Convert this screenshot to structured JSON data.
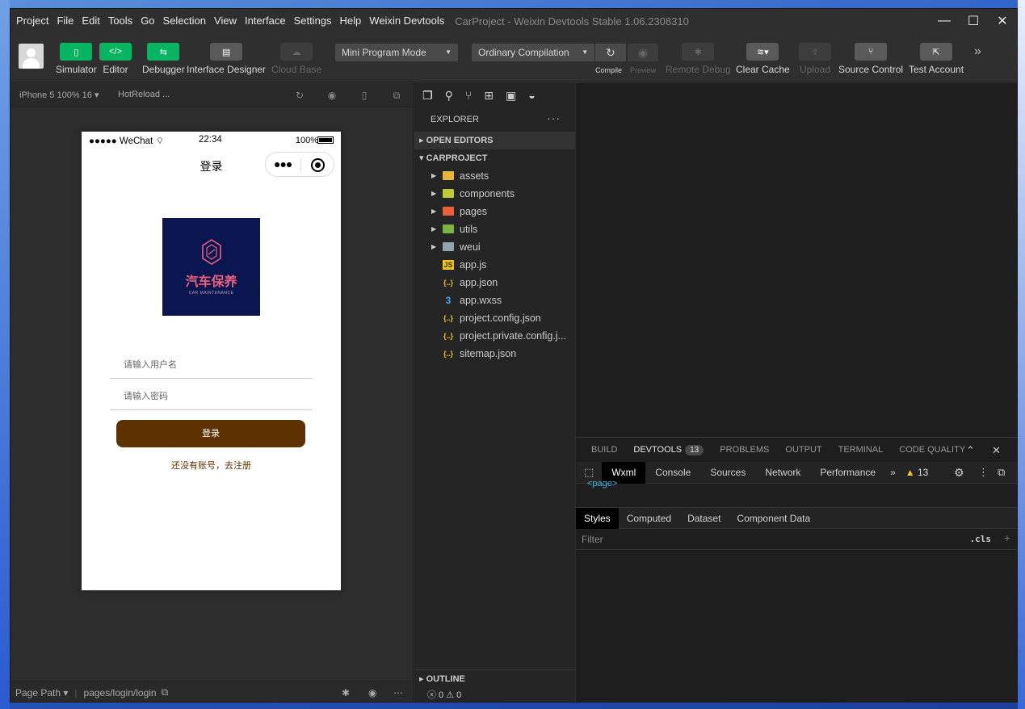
{
  "menu": [
    "Project",
    "File",
    "Edit",
    "Tools",
    "Go",
    "Selection",
    "View",
    "Interface",
    "Settings",
    "Help",
    "Weixin Devtools"
  ],
  "window_title": "CarProject - Weixin Devtools Stable 1.06.2308310",
  "toolbar": {
    "simulator": "Simulator",
    "editor": "Editor",
    "debugger": "Debugger",
    "interface_designer": "Interface Designer",
    "cloud_base": "Cloud Base",
    "mode": "Mini Program Mode",
    "compilation": "Ordinary Compilation",
    "compile": "Compile",
    "preview": "Preview",
    "remote_debug": "Remote Debug",
    "clear_cache": "Clear Cache",
    "upload": "Upload",
    "source_control": "Source Control",
    "test_account": "Test Account"
  },
  "simulator": {
    "device": "iPhone 5 100% 16",
    "hotreload": "HotReload ...",
    "status_left": "●●●●● WeChat",
    "status_time": "22:34",
    "status_battery": "100%",
    "nav_title": "登录",
    "logo_text": "汽车保养",
    "logo_sub": "CAR MAINTENANCE",
    "username_placeholder": "请输入用户名",
    "password_placeholder": "请输入密码",
    "login_button": "登录",
    "register_link": "还没有账号，去注册",
    "page_path_label": "Page Path",
    "page_path": "pages/login/login"
  },
  "explorer": {
    "title": "EXPLORER",
    "open_editors": "OPEN EDITORS",
    "project": "CARPROJECT",
    "items": [
      {
        "name": "assets",
        "type": "folder",
        "color": "#e8b43a"
      },
      {
        "name": "components",
        "type": "folder",
        "color": "#c0ca33"
      },
      {
        "name": "pages",
        "type": "folder",
        "color": "#e8613a"
      },
      {
        "name": "utils",
        "type": "folder",
        "color": "#7cb342"
      },
      {
        "name": "weui",
        "type": "folder",
        "color": "#90a4ae"
      },
      {
        "name": "app.js",
        "type": "js",
        "color": "#f0c419"
      },
      {
        "name": "app.json",
        "type": "json",
        "color": "#f0c419"
      },
      {
        "name": "app.wxss",
        "type": "wxss",
        "color": "#42a5f5"
      },
      {
        "name": "project.config.json",
        "type": "json",
        "color": "#f0c419"
      },
      {
        "name": "project.private.config.j...",
        "type": "json",
        "color": "#f0c419"
      },
      {
        "name": "sitemap.json",
        "type": "json",
        "color": "#f0c419"
      }
    ],
    "outline": "OUTLINE",
    "footer": "ⓧ 0 ⚠ 0"
  },
  "panel": {
    "tabs": [
      "BUILD",
      "DEVTOOLS",
      "PROBLEMS",
      "OUTPUT",
      "TERMINAL",
      "CODE QUALITY"
    ],
    "devtools_badge": "13",
    "devtools_tabs": [
      "Wxml",
      "Console",
      "Sources",
      "Network",
      "Performance"
    ],
    "warning_count": "13",
    "wxml_tag": "<page>",
    "style_tabs": [
      "Styles",
      "Computed",
      "Dataset",
      "Component Data"
    ],
    "filter_placeholder": "Filter",
    "cls": ".cls"
  }
}
